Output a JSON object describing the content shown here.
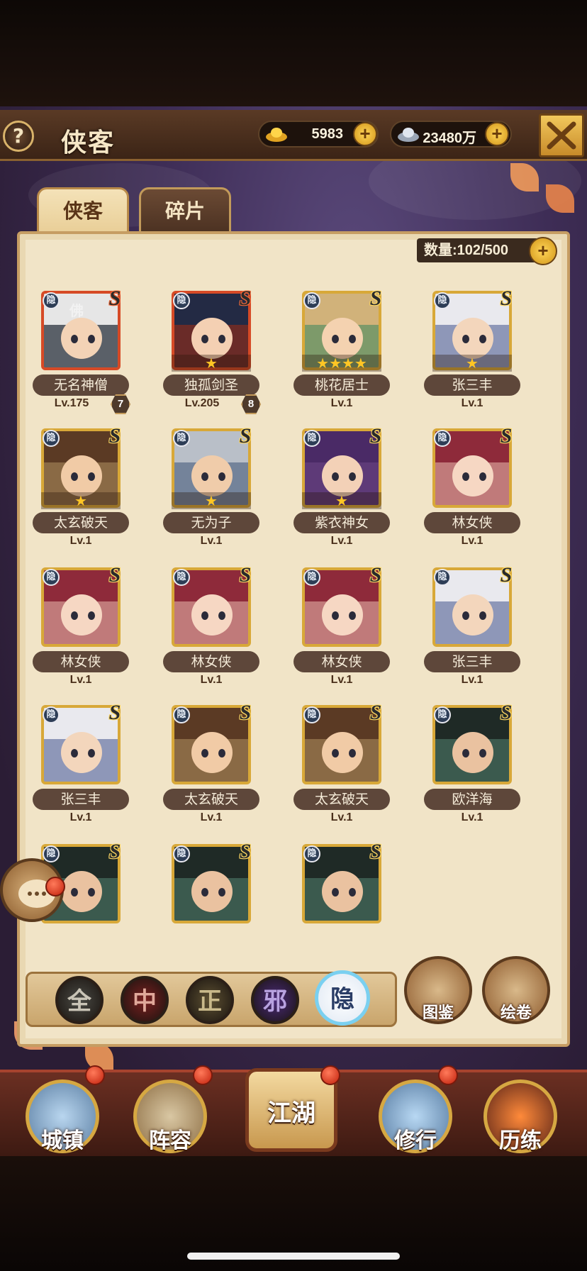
{
  "header": {
    "title": "侠客",
    "help": "?",
    "gold": "5983",
    "silver": "23480万"
  },
  "tabs": [
    {
      "label": "侠客",
      "active": true
    },
    {
      "label": "碎片",
      "active": false
    }
  ],
  "count": "数量:102/500",
  "heroes": [
    {
      "name": "无名神僧",
      "level": "Lv.175",
      "rank": "7",
      "stars": "",
      "frame": "red",
      "hair": "#e6e6e6",
      "face": "#f3d3b6",
      "bg": "#5a6068",
      "portrait_text": "佛"
    },
    {
      "name": "独孤剑圣",
      "level": "Lv.205",
      "rank": "8",
      "stars": "★",
      "frame": "red",
      "hair": "#232a44",
      "face": "#f4d0b3",
      "bg": "#6a2b28",
      "portrait_text": ""
    },
    {
      "name": "桃花居士",
      "level": "Lv.1",
      "rank": "",
      "stars": "★★★★",
      "frame": "gold",
      "hair": "#d1b27a",
      "face": "#f4d2b0",
      "bg": "#7d9a6a",
      "portrait_text": ""
    },
    {
      "name": "张三丰",
      "level": "Lv.1",
      "rank": "",
      "stars": "★",
      "frame": "gold",
      "hair": "#e9e9ee",
      "face": "#f3d6bc",
      "bg": "#8e97b8",
      "portrait_text": ""
    },
    {
      "name": "太玄破天",
      "level": "Lv.1",
      "rank": "",
      "stars": "★",
      "frame": "gold",
      "hair": "#5b3a24",
      "face": "#f1cba6",
      "bg": "#8a6a45",
      "portrait_text": ""
    },
    {
      "name": "无为子",
      "level": "Lv.1",
      "rank": "",
      "stars": "★",
      "frame": "gold",
      "hair": "#b9bfc8",
      "face": "#f0ccaa",
      "bg": "#74839a",
      "portrait_text": ""
    },
    {
      "name": "紫衣神女",
      "level": "Lv.1",
      "rank": "",
      "stars": "★",
      "frame": "gold",
      "hair": "#4a2a66",
      "face": "#f3d1b7",
      "bg": "#5e3a78",
      "portrait_text": ""
    },
    {
      "name": "林女侠",
      "level": "Lv.1",
      "rank": "",
      "stars": "",
      "frame": "gold",
      "hair": "#8e2a3a",
      "face": "#f6d7c3",
      "bg": "#c07a7a",
      "portrait_text": ""
    },
    {
      "name": "林女侠",
      "level": "Lv.1",
      "rank": "",
      "stars": "",
      "frame": "gold",
      "hair": "#8e2a3a",
      "face": "#f6d7c3",
      "bg": "#c07a7a",
      "portrait_text": ""
    },
    {
      "name": "林女侠",
      "level": "Lv.1",
      "rank": "",
      "stars": "",
      "frame": "gold",
      "hair": "#8e2a3a",
      "face": "#f6d7c3",
      "bg": "#c07a7a",
      "portrait_text": ""
    },
    {
      "name": "林女侠",
      "level": "Lv.1",
      "rank": "",
      "stars": "",
      "frame": "gold",
      "hair": "#8e2a3a",
      "face": "#f6d7c3",
      "bg": "#c07a7a",
      "portrait_text": ""
    },
    {
      "name": "张三丰",
      "level": "Lv.1",
      "rank": "",
      "stars": "",
      "frame": "gold",
      "hair": "#e9e9ee",
      "face": "#f3d6bc",
      "bg": "#8e97b8",
      "portrait_text": ""
    },
    {
      "name": "张三丰",
      "level": "Lv.1",
      "rank": "",
      "stars": "",
      "frame": "gold",
      "hair": "#e9e9ee",
      "face": "#f3d6bc",
      "bg": "#8e97b8",
      "portrait_text": ""
    },
    {
      "name": "太玄破天",
      "level": "Lv.1",
      "rank": "",
      "stars": "",
      "frame": "gold",
      "hair": "#5b3a24",
      "face": "#f1cba6",
      "bg": "#8a6a45",
      "portrait_text": ""
    },
    {
      "name": "太玄破天",
      "level": "Lv.1",
      "rank": "",
      "stars": "",
      "frame": "gold",
      "hair": "#5b3a24",
      "face": "#f1cba6",
      "bg": "#8a6a45",
      "portrait_text": ""
    },
    {
      "name": "欧洋海",
      "level": "Lv.1",
      "rank": "",
      "stars": "",
      "frame": "gold",
      "hair": "#1f2a26",
      "face": "#eac2a0",
      "bg": "#3b5a4e",
      "portrait_text": ""
    },
    {
      "name": "",
      "level": "",
      "rank": "",
      "stars": "",
      "frame": "gold",
      "hair": "#1f2a26",
      "face": "#eac2a0",
      "bg": "#3b5a4e",
      "portrait_text": ""
    },
    {
      "name": "",
      "level": "",
      "rank": "",
      "stars": "",
      "frame": "gold",
      "hair": "#1f2a26",
      "face": "#eac2a0",
      "bg": "#3b5a4e",
      "portrait_text": ""
    },
    {
      "name": "",
      "level": "",
      "rank": "",
      "stars": "",
      "frame": "gold",
      "hair": "#1f2a26",
      "face": "#eac2a0",
      "bg": "#3b5a4e",
      "portrait_text": ""
    }
  ],
  "badge_yin": "隐",
  "badge_s": "S",
  "filters": [
    {
      "label": "全",
      "color": "#4a4a44",
      "text": "#c9c4b6"
    },
    {
      "label": "中",
      "color": "#7a1f1f",
      "text": "#e0a89a"
    },
    {
      "label": "正",
      "color": "#5e5132",
      "text": "#c9b98a"
    },
    {
      "label": "邪",
      "color": "#4b2a7a",
      "text": "#b8a2e0"
    },
    {
      "label": "隐",
      "color": "#eef2f8",
      "text": "#2a3d66"
    }
  ],
  "side_buttons": [
    {
      "label": "图鉴"
    },
    {
      "label": "绘卷"
    }
  ],
  "nav": [
    {
      "label": "城镇",
      "badge": true
    },
    {
      "label": "阵容",
      "badge": true
    },
    {
      "label": "江湖",
      "badge": true
    },
    {
      "label": "修行",
      "badge": true
    },
    {
      "label": "历练",
      "badge": false
    }
  ]
}
